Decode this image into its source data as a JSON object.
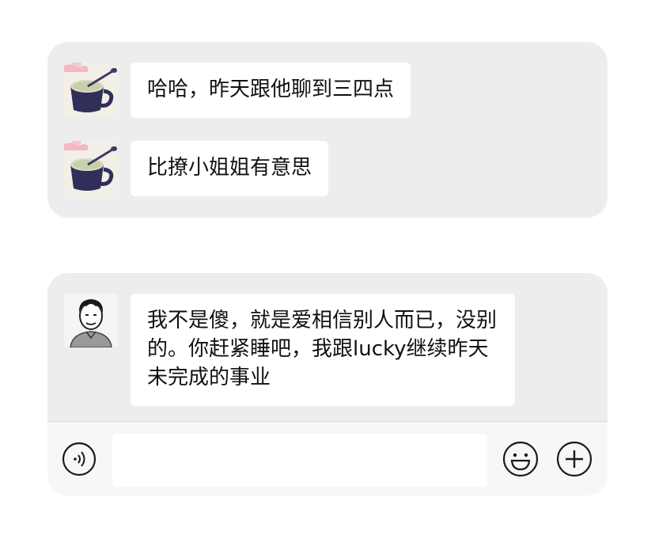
{
  "chat_top": {
    "messages": [
      {
        "sender_avatar": "tea-cup-avatar",
        "text": "哈哈，昨天跟他聊到三四点"
      },
      {
        "sender_avatar": "tea-cup-avatar",
        "text": "比撩小姐姐有意思"
      }
    ]
  },
  "chat_bottom": {
    "messages": [
      {
        "sender_avatar": "cartoon-boy-avatar",
        "text": "我不是傻，就是爱相信别人而已，没别的。你赶紧睡吧，我跟lucky继续昨天未完成的事业"
      }
    ]
  },
  "input_bar": {
    "message_value": "",
    "icons": {
      "voice": "voice-icon",
      "emoji": "emoji-icon",
      "more": "plus-icon"
    }
  },
  "colors": {
    "card_background": "#ededed",
    "bubble_background": "#ffffff",
    "input_bar_background": "#f7f7f7",
    "text": "#111111",
    "icon_stroke": "#1a1a1a"
  }
}
